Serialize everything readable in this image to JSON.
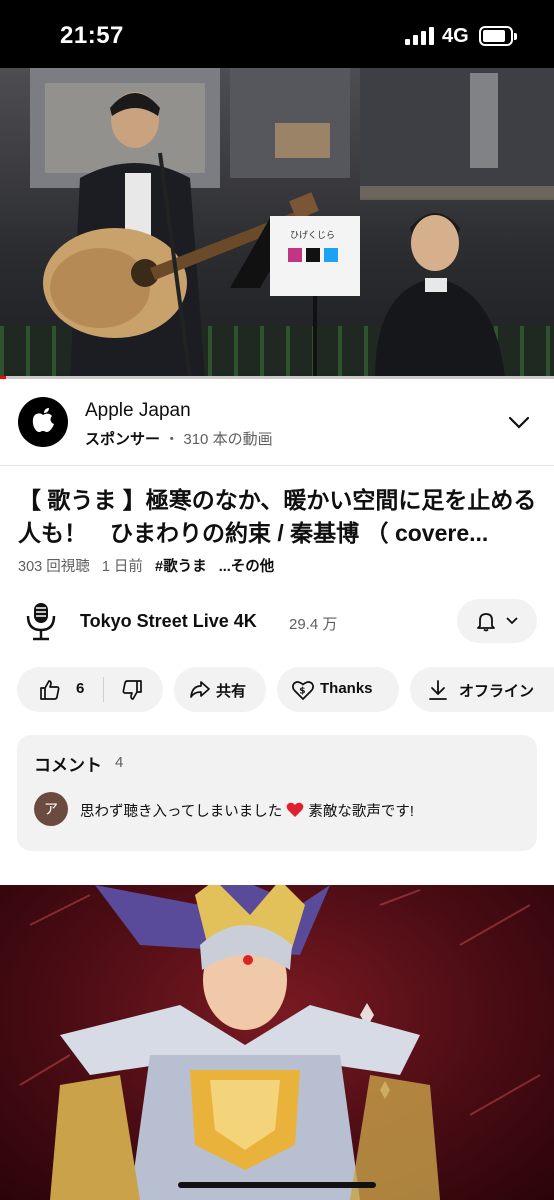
{
  "status_bar": {
    "time": "21:57",
    "network": "4G"
  },
  "video": {
    "progress_fraction": 0.01,
    "accent_color": "#ff0000",
    "sign_text": "ひげくじら"
  },
  "sponsor": {
    "name": "Apple Japan",
    "label": "スポンサー",
    "separator": "・",
    "video_count": "310 本の動画",
    "logo_icon": "apple-logo-icon"
  },
  "video_info": {
    "title": "【 歌うま 】極寒のなか、暖かい空間に足を止める人も！　ひまわりの約束 / 秦基博 （ covere...",
    "views": "303 回視聴",
    "age": "1 日前",
    "hashtag": "#歌うま",
    "more": "...その他"
  },
  "channel": {
    "name": "Tokyo Street Live 4K",
    "subscribers": "29.4 万",
    "icon": "microphone-logo-icon"
  },
  "actions": {
    "like_count": "6",
    "share_label": "共有",
    "thanks_label": "Thanks",
    "offline_label": "オフライン"
  },
  "comments": {
    "heading": "コメント",
    "count": "4",
    "avatar_letter": "ア",
    "top_comment_before": "思わず聴き入ってしまいました",
    "top_comment_after": "素敵な歌声です!"
  },
  "colors": {
    "pill_background": "#f2f2f2",
    "secondary_text": "#606060"
  }
}
